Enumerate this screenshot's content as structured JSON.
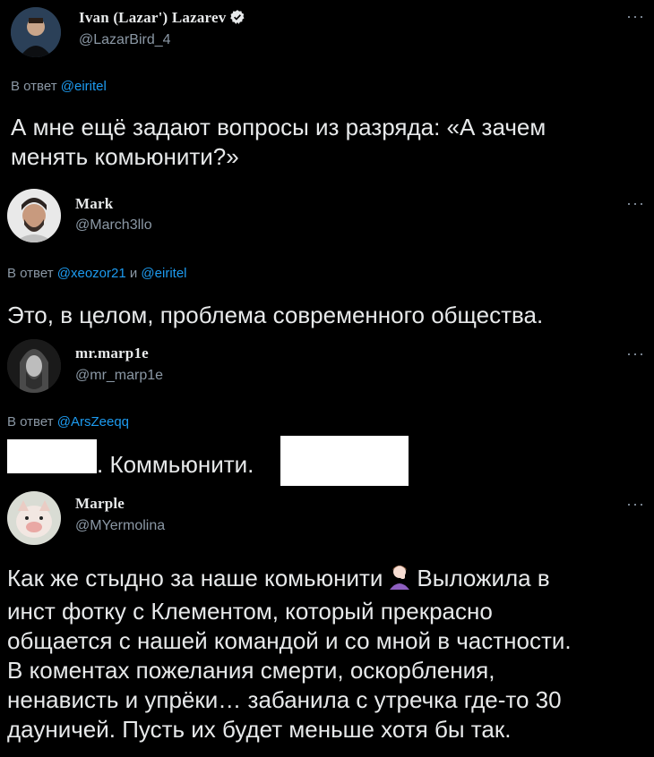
{
  "tweets": [
    {
      "name": "Ivan (Lazar') Lazarev",
      "handle": "@LazarBird_4",
      "more": "···",
      "reply_prefix": "В ответ",
      "reply_mention1": "@eiritel",
      "text1": "А мне ещё задают вопросы из разряда: «А зачем",
      "text2": "менять комьюнити?»"
    },
    {
      "name": "Mark",
      "handle": "@March3llo",
      "more": "···",
      "reply_prefix": "В ответ",
      "reply_mention1": "@xeozor21",
      "reply_and": "и",
      "reply_mention2": "@eiritel",
      "text1": "Это, в целом, проблема современного общества."
    },
    {
      "name": "mr.marp1e",
      "handle": "@mr_marp1e",
      "more": "···",
      "reply_prefix": "В ответ",
      "reply_mention1": "@ArsZeeqq",
      "text1": ". Коммьюнити."
    },
    {
      "name": "Marple",
      "handle": "@MYermolina",
      "more": "···",
      "line1a": "Как же стыдно за наше комьюнити",
      "line1b": "Выложила в",
      "line2": "инст фотку с Клементом, который прекрасно",
      "line3": "общается с нашей командой и со мной в частности.",
      "line4": "В коментах пожелания смерти, оскорбления,",
      "line5": "ненависть и упрёки… забанила с утречка где-то 30",
      "line6": "дауничей. Пусть их будет меньше хотя бы так."
    }
  ],
  "icons": {
    "verified": "verified-badge-icon",
    "emoji": "facepalm-woman-emoji"
  },
  "colors": {
    "background": "#000000",
    "text": "#e7e9ea",
    "secondary": "#8b98a5",
    "link": "#1d9bf0"
  }
}
